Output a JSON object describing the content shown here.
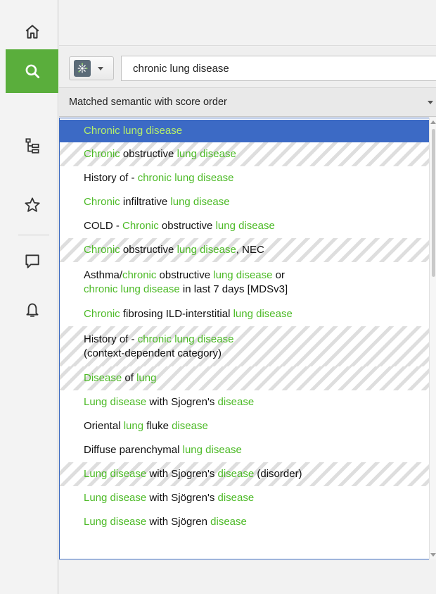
{
  "sidebar": {
    "items": [
      {
        "name": "home",
        "icon": "home-icon"
      },
      {
        "name": "search",
        "icon": "search-icon",
        "active": true
      },
      {
        "name": "hierarchy",
        "icon": "hierarchy-icon"
      },
      {
        "name": "favorites",
        "icon": "star-icon"
      },
      {
        "name": "comments",
        "icon": "comment-icon"
      },
      {
        "name": "notifications",
        "icon": "bell-icon"
      }
    ]
  },
  "search": {
    "type_icon": "concept-type-icon",
    "query": "chronic lung disease"
  },
  "order": {
    "selected": "Matched semantic with score order"
  },
  "colors": {
    "accent": "#5aae3c",
    "highlight": "#4cba26",
    "selection": "#3c6ac5"
  },
  "results": [
    {
      "lines": [
        [
          [
            "Chronic lung disease",
            true
          ]
        ]
      ],
      "selected": true
    },
    {
      "lines": [
        [
          [
            "Chronic",
            true
          ],
          [
            " obstructive ",
            false
          ],
          [
            "lung disease",
            true
          ]
        ]
      ]
    },
    {
      "lines": [
        [
          [
            "History of - ",
            false
          ],
          [
            "chronic lung disease",
            true
          ]
        ]
      ]
    },
    {
      "lines": [
        [
          [
            "Chronic",
            true
          ],
          [
            " infiltrative ",
            false
          ],
          [
            "lung disease",
            true
          ]
        ]
      ]
    },
    {
      "lines": [
        [
          [
            "COLD - ",
            false
          ],
          [
            "Chronic",
            true
          ],
          [
            " obstructive ",
            false
          ],
          [
            "lung disease",
            true
          ]
        ]
      ]
    },
    {
      "lines": [
        [
          [
            "Chronic",
            true
          ],
          [
            " obstructive ",
            false
          ],
          [
            "lung disease",
            true
          ],
          [
            ", NEC",
            false
          ]
        ]
      ]
    },
    {
      "lines": [
        [
          [
            "Asthma/",
            false
          ],
          [
            "chronic",
            true
          ],
          [
            " obstructive ",
            false
          ],
          [
            "lung disease",
            true
          ],
          [
            " or",
            false
          ]
        ],
        [
          [
            "chronic lung disease",
            true
          ],
          [
            " in last 7 days [MDSv3]",
            false
          ]
        ]
      ]
    },
    {
      "lines": [
        [
          [
            "Chronic",
            true
          ],
          [
            " fibrosing ILD-interstitial ",
            false
          ],
          [
            "lung disease",
            true
          ]
        ]
      ]
    },
    {
      "lines": [
        [
          [
            "History of - ",
            false
          ],
          [
            "chronic lung disease",
            true
          ]
        ],
        [
          [
            "(context-dependent category)",
            false
          ]
        ]
      ]
    },
    {
      "lines": [
        [
          [
            "Disease",
            true
          ],
          [
            " of ",
            false
          ],
          [
            "lung",
            true
          ]
        ]
      ]
    },
    {
      "lines": [
        [
          [
            "Lung disease",
            true
          ],
          [
            " with Sjogren's ",
            false
          ],
          [
            "disease",
            true
          ]
        ]
      ]
    },
    {
      "lines": [
        [
          [
            "Oriental ",
            false
          ],
          [
            "lung",
            true
          ],
          [
            " fluke ",
            false
          ],
          [
            "disease",
            true
          ]
        ]
      ]
    },
    {
      "lines": [
        [
          [
            "Diffuse parenchymal ",
            false
          ],
          [
            "lung disease",
            true
          ]
        ]
      ]
    },
    {
      "lines": [
        [
          [
            "Lung disease",
            true
          ],
          [
            " with Sjogren's ",
            false
          ],
          [
            "disease",
            true
          ],
          [
            " (disorder)",
            false
          ]
        ]
      ]
    },
    {
      "lines": [
        [
          [
            "Lung disease",
            true
          ],
          [
            " with Sjögren's ",
            false
          ],
          [
            "disease",
            true
          ]
        ]
      ]
    },
    {
      "lines": [
        [
          [
            "Lung disease",
            true
          ],
          [
            " with Sjögren ",
            false
          ],
          [
            "disease",
            true
          ]
        ]
      ]
    }
  ]
}
